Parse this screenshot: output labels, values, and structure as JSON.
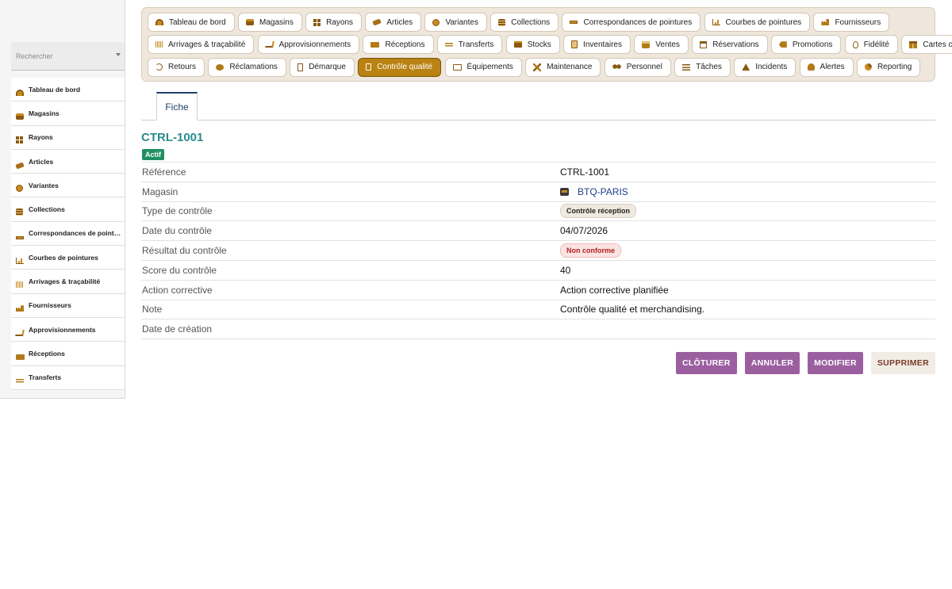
{
  "sidebar": {
    "search_placeholder": "Rechercher",
    "items": [
      {
        "label": "Tableau de bord",
        "icon": "dashboard-icon"
      },
      {
        "label": "Magasins",
        "icon": "store-icon"
      },
      {
        "label": "Rayons",
        "icon": "grid-icon"
      },
      {
        "label": "Articles",
        "icon": "tag-icon"
      },
      {
        "label": "Variantes",
        "icon": "palette-icon"
      },
      {
        "label": "Collections",
        "icon": "stack-icon"
      },
      {
        "label": "Correspondances de pointures",
        "icon": "ruler-icon"
      },
      {
        "label": "Courbes de pointures",
        "icon": "chart-icon"
      },
      {
        "label": "Arrivages & traçabilité",
        "icon": "barcode-icon"
      },
      {
        "label": "Fournisseurs",
        "icon": "factory-icon"
      },
      {
        "label": "Approvisionnements",
        "icon": "cart-icon"
      },
      {
        "label": "Réceptions",
        "icon": "truck-icon"
      },
      {
        "label": "Transferts",
        "icon": "arrows-icon"
      }
    ]
  },
  "modules": {
    "row1": [
      {
        "label": "Tableau de bord",
        "icon": "dashboard-icon"
      },
      {
        "label": "Magasins",
        "icon": "store-icon"
      },
      {
        "label": "Rayons",
        "icon": "grid-icon"
      },
      {
        "label": "Articles",
        "icon": "tag-icon"
      },
      {
        "label": "Variantes",
        "icon": "palette-icon"
      },
      {
        "label": "Collections",
        "icon": "stack-icon"
      },
      {
        "label": "Correspondances de pointures",
        "icon": "ruler-icon"
      },
      {
        "label": "Courbes de pointures",
        "icon": "chart-icon"
      },
      {
        "label": "Fournisseurs",
        "icon": "factory-icon"
      }
    ],
    "row2": [
      {
        "label": "Arrivages & traçabilité",
        "icon": "barcode-icon"
      },
      {
        "label": "Approvisionnements",
        "icon": "cart-icon"
      },
      {
        "label": "Réceptions",
        "icon": "truck-icon"
      },
      {
        "label": "Transferts",
        "icon": "arrows-icon"
      },
      {
        "label": "Stocks",
        "icon": "box-icon"
      },
      {
        "label": "Inventaires",
        "icon": "clipboard-icon"
      },
      {
        "label": "Ventes",
        "icon": "bag-icon"
      },
      {
        "label": "Réservations",
        "icon": "calendar-icon"
      },
      {
        "label": "Promotions",
        "icon": "promo-icon"
      },
      {
        "label": "Fidélité",
        "icon": "medal-icon"
      },
      {
        "label": "Cartes cadeaux",
        "icon": "gift-icon"
      }
    ],
    "row3": [
      {
        "label": "Retours",
        "icon": "undo-icon"
      },
      {
        "label": "Réclamations",
        "icon": "bubble-icon"
      },
      {
        "label": "Démarque",
        "icon": "document-icon"
      },
      {
        "label": "Contrôle qualité",
        "icon": "clipboard-icon",
        "active": true
      },
      {
        "label": "Équipements",
        "icon": "monitor-icon"
      },
      {
        "label": "Maintenance",
        "icon": "tools-icon"
      },
      {
        "label": "Personnel",
        "icon": "people-icon"
      },
      {
        "label": "Tâches",
        "icon": "list-icon"
      },
      {
        "label": "Incidents",
        "icon": "warning-icon"
      },
      {
        "label": "Alertes",
        "icon": "bell-icon"
      },
      {
        "label": "Reporting",
        "icon": "pie-icon"
      }
    ]
  },
  "tabs": [
    {
      "label": "Fiche"
    }
  ],
  "record": {
    "title": "CTRL-1001",
    "status": "Actif",
    "fields": [
      {
        "label": "Référence",
        "value": "CTRL-1001"
      },
      {
        "label": "Magasin",
        "value": "BTQ-PARIS"
      },
      {
        "label": "Type de contrôle",
        "value": "Contrôle réception"
      },
      {
        "label": "Date du contrôle",
        "value": "04/07/2026"
      },
      {
        "label": "Résultat du contrôle",
        "value": "Non conforme"
      },
      {
        "label": "Score du contrôle",
        "value": "40"
      },
      {
        "label": "Action corrective",
        "value": "Action corrective planifiée"
      },
      {
        "label": "Note",
        "value": "Contrôle qualité et merchandising."
      },
      {
        "label": "Date de création",
        "value": ""
      }
    ]
  },
  "actions": {
    "close": "CLÔTURER",
    "cancel": "ANNULER",
    "edit": "MODIFIER",
    "delete": "SUPPRIMER"
  },
  "colors": {
    "accent_active": "#b98212",
    "title": "#2a8c8c",
    "status_active": "#1f8f5f",
    "action_purple": "#9b5fa0",
    "danger": "#b21f1f"
  }
}
